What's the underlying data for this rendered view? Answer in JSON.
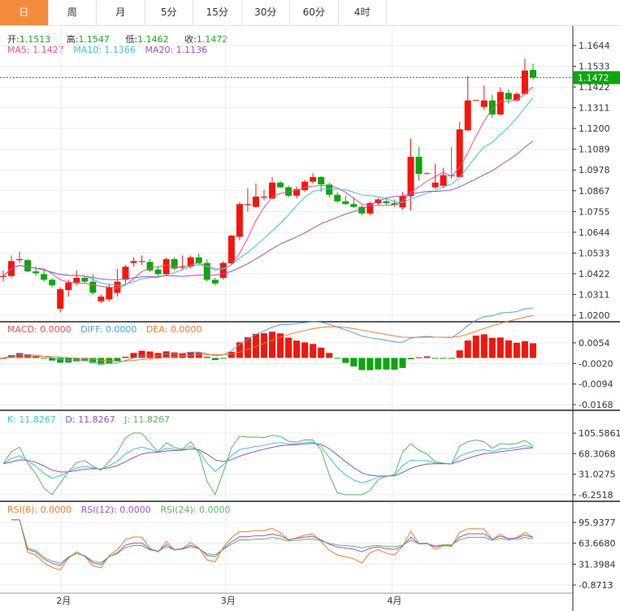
{
  "tabs": [
    {
      "label": "日",
      "active": true
    },
    {
      "label": "周"
    },
    {
      "label": "月"
    },
    {
      "label": "5分"
    },
    {
      "label": "15分"
    },
    {
      "label": "30分"
    },
    {
      "label": "60分"
    },
    {
      "label": "4时"
    }
  ],
  "ohlc_legend": {
    "open_label": "开:",
    "open": "1.1513",
    "high_label": "高:",
    "high": "1.1547",
    "low_label": "低:",
    "low": "1.1462",
    "close_label": "收:",
    "close": "1.1472"
  },
  "ma_legend": {
    "ma5": "MA5: 1.1427",
    "ma10": "MA10: 1.1366",
    "ma20": "MA20: 1.1136"
  },
  "macd_legend": {
    "macd": "MACD: 0.0000",
    "diff": "DIFF: 0.0000",
    "dea": "DEA: 0.0000"
  },
  "kdj_legend": {
    "k": "K: 11.8267",
    "d": "D: 11.8267",
    "j": "J: 11.8267"
  },
  "rsi_legend": {
    "rsi6": "RSI(6): 0.0000",
    "rsi12": "RSI(12): 0.0000",
    "rsi24": "RSI(24): 0.0000"
  },
  "last_price": "1.1472",
  "colors": {
    "up": "#f5150a",
    "down": "#0ea50e",
    "ma5": "#f0508a",
    "ma10": "#3cc4dc",
    "ma20": "#a64fc9",
    "diff": "#4aa3ee",
    "dea": "#f57c22",
    "k": "#3cc4dc",
    "d": "#8e52d0",
    "j": "#5cb85c",
    "rsi6": "#f57c22",
    "rsi12": "#a64fc9",
    "rsi24": "#5cb85c",
    "accent": "#f38b3c",
    "last": "#0ea50e"
  },
  "chart_data": {
    "type": "candlestick",
    "x_labels": [
      {
        "index": 7,
        "label": "2月"
      },
      {
        "index": 27,
        "label": "3月"
      },
      {
        "index": 48,
        "label": "4月"
      }
    ],
    "price_axis": {
      "ticks": [
        "1.1644",
        "1.1533",
        "1.1422",
        "1.1311",
        "1.1200",
        "1.1089",
        "1.0978",
        "1.0867",
        "1.0755",
        "1.0644",
        "1.0533",
        "1.0422",
        "1.0311",
        "1.0200"
      ],
      "range": [
        1.02,
        1.1644
      ]
    },
    "macd_axis": {
      "ticks": [
        "0.0054",
        "-0.0020",
        "-0.0094",
        "-0.0168"
      ],
      "range": [
        -0.0168,
        0.0054
      ]
    },
    "kdj_axis": {
      "ticks": [
        "105.5861",
        "68.3068",
        "31.0275",
        "-6.2518"
      ],
      "range": [
        -6.2518,
        105.5861
      ]
    },
    "rsi_axis": {
      "ticks": [
        "95.9377",
        "63.6680",
        "31.3984",
        "-0.8713"
      ],
      "range": [
        -0.8713,
        95.9377
      ]
    },
    "candles": [
      [
        1.0405,
        1.044,
        1.038,
        1.041
      ],
      [
        1.041,
        1.052,
        1.04,
        1.049
      ],
      [
        1.0495,
        1.054,
        1.048,
        1.05
      ],
      [
        1.0495,
        1.05,
        1.043,
        1.0435
      ],
      [
        1.0435,
        1.046,
        1.041,
        1.0425
      ],
      [
        1.042,
        1.044,
        1.038,
        1.039
      ],
      [
        1.039,
        1.04,
        1.035,
        1.036
      ],
      [
        1.0235,
        1.035,
        1.0215,
        1.034
      ],
      [
        1.0335,
        1.039,
        1.03,
        1.0375
      ],
      [
        1.0375,
        1.044,
        1.036,
        1.04
      ],
      [
        1.04,
        1.041,
        1.037,
        1.038
      ],
      [
        1.038,
        1.042,
        1.031,
        1.032
      ],
      [
        1.0275,
        1.031,
        1.0265,
        1.03
      ],
      [
        1.0285,
        1.037,
        1.0275,
        1.035
      ],
      [
        1.032,
        1.045,
        1.03,
        1.038
      ],
      [
        1.039,
        1.047,
        1.037,
        1.046
      ],
      [
        1.048,
        1.051,
        1.046,
        1.049
      ],
      [
        1.0485,
        1.052,
        1.047,
        1.049
      ],
      [
        1.0485,
        1.05,
        1.043,
        1.044
      ],
      [
        1.0445,
        1.046,
        1.041,
        1.042
      ],
      [
        1.042,
        1.051,
        1.0415,
        1.05
      ],
      [
        1.05,
        1.051,
        1.044,
        1.045
      ],
      [
        1.046,
        1.052,
        1.044,
        1.0462
      ],
      [
        1.046,
        1.052,
        1.045,
        1.051
      ],
      [
        1.051,
        1.053,
        1.047,
        1.048
      ],
      [
        1.048,
        1.05,
        1.038,
        1.039
      ],
      [
        1.039,
        1.04,
        1.036,
        1.037
      ],
      [
        1.04,
        1.049,
        1.039,
        1.048
      ],
      [
        1.0478,
        1.063,
        1.047,
        1.0626
      ],
      [
        1.062,
        1.0805,
        1.06,
        1.0795
      ],
      [
        1.079,
        1.088,
        1.0755,
        1.0795
      ],
      [
        1.078,
        1.0905,
        1.0775,
        1.0835
      ],
      [
        1.083,
        1.087,
        1.0815,
        1.0835
      ],
      [
        1.0825,
        1.094,
        1.082,
        1.091
      ],
      [
        1.091,
        1.092,
        1.088,
        1.0885
      ],
      [
        1.0885,
        1.0895,
        1.083,
        1.084
      ],
      [
        1.084,
        1.089,
        1.0825,
        1.0875
      ],
      [
        1.087,
        1.0925,
        1.086,
        1.0915
      ],
      [
        1.0915,
        1.096,
        1.0905,
        1.094
      ],
      [
        1.094,
        1.0945,
        1.086,
        1.09
      ],
      [
        1.09,
        1.091,
        1.083,
        1.0845
      ],
      [
        1.0845,
        1.086,
        1.08,
        1.081
      ],
      [
        1.081,
        1.084,
        1.079,
        1.0795
      ],
      [
        1.0795,
        1.083,
        1.0775,
        1.078
      ],
      [
        1.078,
        1.079,
        1.0735,
        1.0745
      ],
      [
        1.0745,
        1.081,
        1.0735,
        1.08
      ],
      [
        1.08,
        1.083,
        1.079,
        1.082
      ],
      [
        1.081,
        1.083,
        1.079,
        1.08
      ],
      [
        1.08,
        1.082,
        1.078,
        1.079
      ],
      [
        1.0777,
        1.086,
        1.0765,
        1.0838
      ],
      [
        1.0838,
        1.1145,
        1.076,
        1.1048
      ],
      [
        1.1048,
        1.11,
        1.092,
        1.0957
      ],
      [
        1.096,
        1.0965,
        1.0955,
        1.096
      ],
      [
        1.0885,
        1.101,
        1.0875,
        1.091
      ],
      [
        1.0893,
        1.099,
        1.088,
        1.095
      ],
      [
        1.095,
        1.11,
        1.093,
        1.0945
      ],
      [
        1.094,
        1.1235,
        1.0935,
        1.1195
      ],
      [
        1.119,
        1.148,
        1.1185,
        1.135
      ],
      [
        1.135,
        1.1352,
        1.1348,
        1.1352
      ],
      [
        1.1315,
        1.143,
        1.13,
        1.135
      ],
      [
        1.135,
        1.138,
        1.1255,
        1.1275
      ],
      [
        1.1275,
        1.142,
        1.127,
        1.1395
      ],
      [
        1.139,
        1.141,
        1.133,
        1.1355
      ],
      [
        1.135,
        1.1395,
        1.1345,
        1.1385
      ],
      [
        1.1385,
        1.1573,
        1.138,
        1.151
      ],
      [
        1.1513,
        1.1547,
        1.1462,
        1.1472
      ]
    ]
  }
}
